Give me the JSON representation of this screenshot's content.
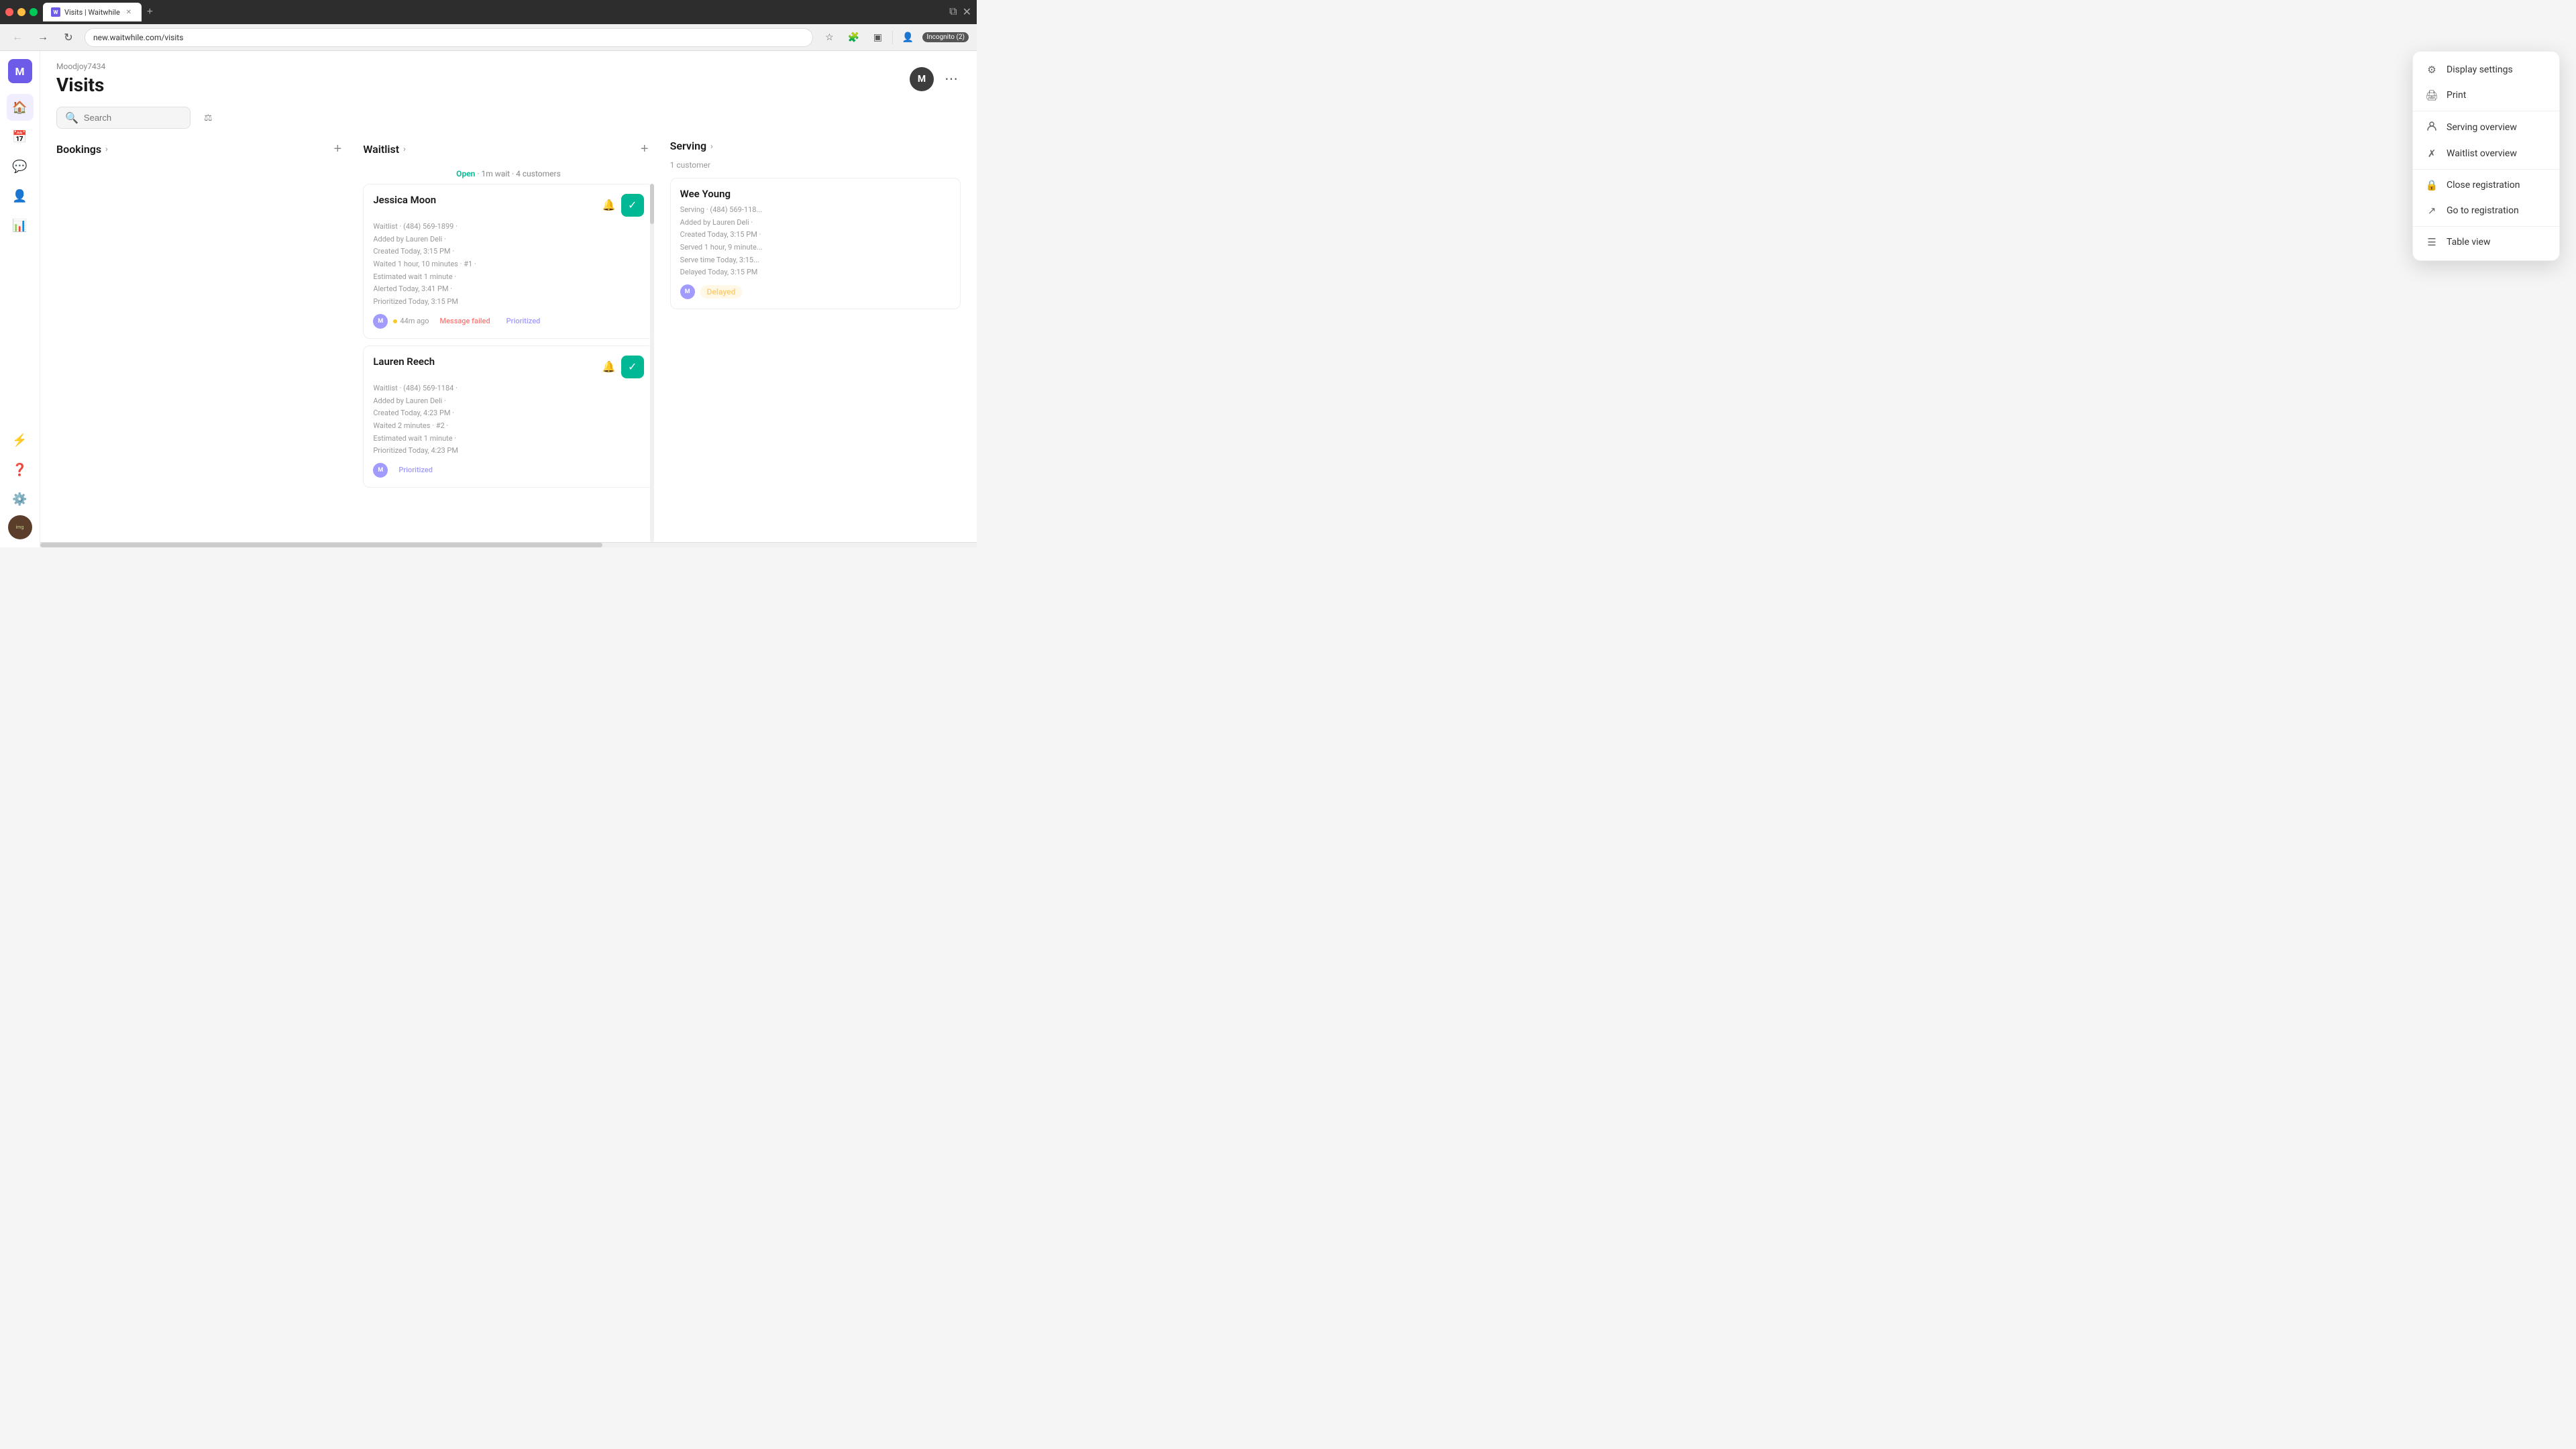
{
  "browser": {
    "tab_label": "Visits | Waitwhile",
    "url": "new.waitwhile.com/visits",
    "incognito_label": "Incognito (2)"
  },
  "app": {
    "org_name": "Moodjoy7434",
    "page_title": "Visits",
    "user_initial": "M"
  },
  "nav": {
    "logo_initial": "M",
    "items": [
      {
        "icon": "🏠",
        "label": "Home",
        "active": true
      },
      {
        "icon": "📅",
        "label": "Bookings",
        "active": false
      },
      {
        "icon": "💬",
        "label": "Messages",
        "active": false
      },
      {
        "icon": "👤",
        "label": "Customers",
        "active": false
      },
      {
        "icon": "📊",
        "label": "Reports",
        "active": false
      },
      {
        "icon": "⚙️",
        "label": "Settings",
        "active": false
      }
    ]
  },
  "toolbar": {
    "search_placeholder": "Search",
    "filter_label": "Filter"
  },
  "columns": {
    "bookings": {
      "title": "Bookings",
      "add_label": "+"
    },
    "waitlist": {
      "title": "Waitlist",
      "add_label": "+",
      "status_open": "Open",
      "status_detail": "· 1m wait · 4 customers",
      "customers": [
        {
          "name": "Jessica Moon",
          "info_line1": "Waitlist · (484) 569-1899 ·",
          "info_line2": "Added by Lauren Deli ·",
          "info_line3": "Created Today, 3:15 PM ·",
          "info_line4": "Waited 1 hour, 10 minutes · #1 ·",
          "info_line5": "Estimated wait 1 minute ·",
          "info_line6": "Alerted Today, 3:41 PM ·",
          "info_line7": "Prioritized Today, 3:15 PM",
          "time_ago": "44m ago",
          "badge_failed": "Message failed",
          "badge_prioritized": "Prioritized",
          "avatar_initial": "M"
        },
        {
          "name": "Lauren Reech",
          "info_line1": "Waitlist · (484) 569-1184 ·",
          "info_line2": "Added by Lauren Deli ·",
          "info_line3": "Created Today, 4:23 PM ·",
          "info_line4": "Waited 2 minutes · #2 ·",
          "info_line5": "Estimated wait 1 minute ·",
          "info_line6": "Prioritized Today, 4:23 PM",
          "badge_prioritized": "Prioritized",
          "avatar_initial": "M"
        }
      ]
    },
    "serving": {
      "title": "Serving",
      "customer_count": "1 customer",
      "customers": [
        {
          "name": "Wee Young",
          "info_line1": "Serving · (484) 569-118...",
          "info_line2": "Added by Lauren Deli ·",
          "info_line3": "Created Today, 3:15 PM ·",
          "info_line4": "Served 1 hour, 9 minute...",
          "info_line5": "Serve time Today, 3:15...",
          "info_line6": "Delayed Today, 3:15 PM",
          "badge_delayed": "Delayed",
          "avatar_initial": "M"
        }
      ]
    }
  },
  "dropdown": {
    "items": [
      {
        "icon": "⚙",
        "label": "Display settings",
        "name": "display-settings"
      },
      {
        "icon": "🖨",
        "label": "Print",
        "name": "print"
      },
      {
        "icon": "👤",
        "label": "Serving overview",
        "name": "serving-overview"
      },
      {
        "icon": "✗",
        "label": "Waitlist overview",
        "name": "waitlist-overview"
      },
      {
        "icon": "🔒",
        "label": "Close registration",
        "name": "close-registration"
      },
      {
        "icon": "↗",
        "label": "Go to registration",
        "name": "go-to-registration"
      },
      {
        "icon": "☰",
        "label": "Table view",
        "name": "table-view"
      }
    ]
  }
}
